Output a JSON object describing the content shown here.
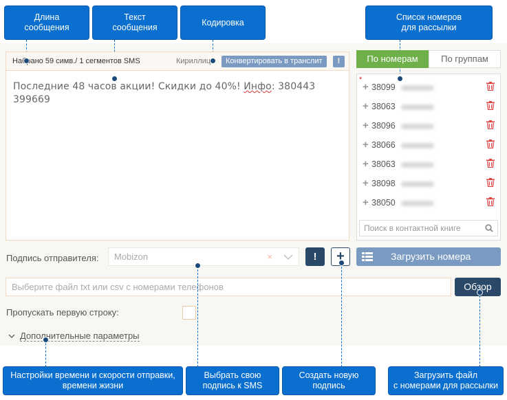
{
  "callouts": {
    "length": "Длина\nсообщения",
    "text": "Текст\nсообщения",
    "encoding": "Кодировка",
    "numbers_list": "Список номеров\nдля рассылки",
    "time_settings": "Настройки времени и скорости отправки,\nвремени жизни",
    "choose_signature": "Выбрать свою\nподпись к SMS",
    "create_signature": "Создать новую\nподпись",
    "upload_file": "Загрузить файл\nс номерами для рассылки"
  },
  "message": {
    "count_label": "Набрано 59 симв./ 1 сегментов SMS",
    "encoding_value": "Кириллица",
    "translit_button": "Конвертировать в транслит",
    "info_button": "!",
    "text_part1": "Последние 48 часов акции! Скидки до 40%! ",
    "text_spell": "Инфо",
    "text_part2": ": 380443\n399669"
  },
  "tabs": {
    "by_numbers": "По номерам",
    "by_groups": "По группам"
  },
  "numbers": [
    {
      "prefix": "38099"
    },
    {
      "prefix": "38063"
    },
    {
      "prefix": "38096"
    },
    {
      "prefix": "38066"
    },
    {
      "prefix": "38063"
    },
    {
      "prefix": "38098"
    },
    {
      "prefix": "38050"
    }
  ],
  "contact_search": {
    "placeholder": "Поиск в контактной книге"
  },
  "signature": {
    "label": "Подпись отправителя:",
    "value": "Mobizon",
    "clear": "×",
    "info_button": "!",
    "add_button": "+"
  },
  "upload_numbers_button": "Загрузить номера",
  "file": {
    "placeholder": "Выберите файл txt или csv с номерами телефонов",
    "browse_button": "Обзор"
  },
  "skip_first_row": {
    "label": "Пропускать первую строку:"
  },
  "extra_params": {
    "label": "Дополнительные параметры"
  },
  "colors": {
    "callout": "#0a6fce",
    "active_tab": "#6fb04a",
    "button_dark": "#2a4868",
    "button_light": "#7a9ac2",
    "trash": "#e04040"
  }
}
